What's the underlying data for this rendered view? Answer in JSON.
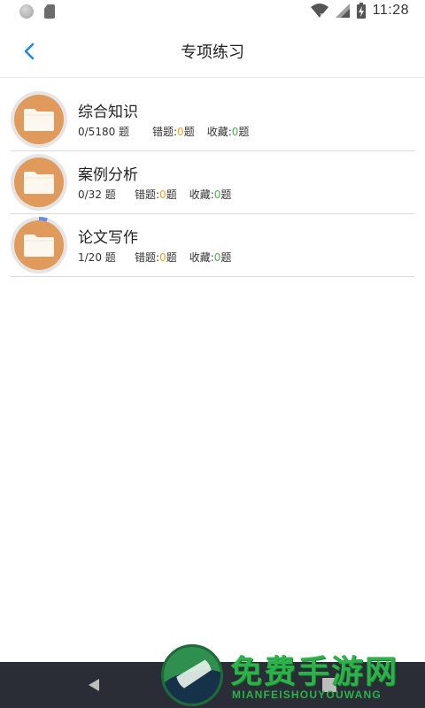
{
  "status_bar": {
    "time": "11:28"
  },
  "header": {
    "title": "专项练习"
  },
  "items": [
    {
      "name": "综合知识",
      "progress_text": "0/5180 题",
      "wrong_label": "错题:",
      "wrong_count": "0",
      "wrong_suffix": "题",
      "fav_label": "收藏:",
      "fav_count": "0",
      "fav_suffix": "题",
      "progress_fraction": 0
    },
    {
      "name": "案例分析",
      "progress_text": "0/32 题",
      "wrong_label": "错题:",
      "wrong_count": "0",
      "wrong_suffix": "题",
      "fav_label": "收藏:",
      "fav_count": "0",
      "fav_suffix": "题",
      "progress_fraction": 0
    },
    {
      "name": "论文写作",
      "progress_text": "1/20 题",
      "wrong_label": "错题:",
      "wrong_count": "0",
      "wrong_suffix": "题",
      "fav_label": "收藏:",
      "fav_count": "0",
      "fav_suffix": "题",
      "progress_fraction": 0.05
    }
  ],
  "watermark": {
    "title": "免费手游网",
    "subtitle": "MIANFEISHOUYOUWANG"
  },
  "colors": {
    "accent": "#1e88e5",
    "folder": "#e09a5b",
    "wrong": "#f0a024",
    "favorite": "#4caf50",
    "progress_arc": "#5b8def"
  }
}
